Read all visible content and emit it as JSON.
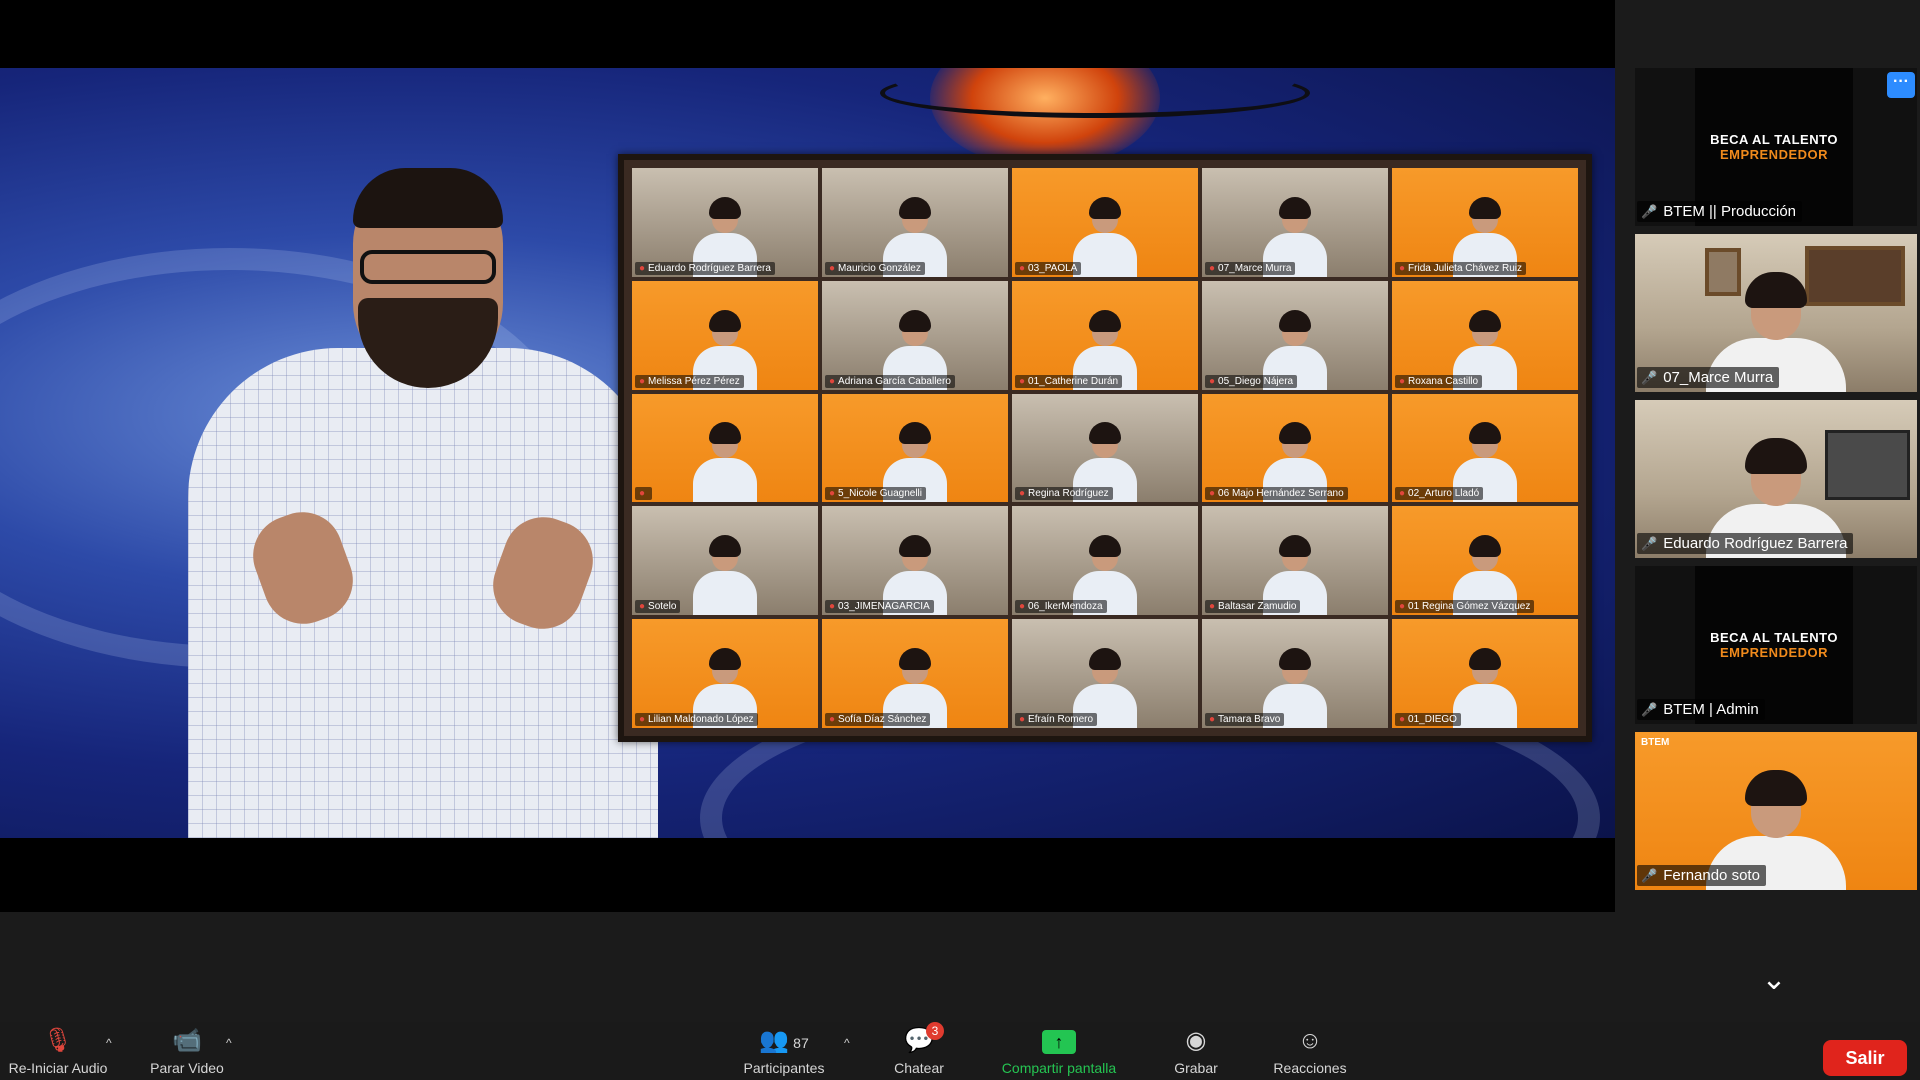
{
  "gallery": {
    "tiles": [
      {
        "name": "Eduardo Rodríguez Barrera",
        "bg": "room"
      },
      {
        "name": "Mauricio González",
        "bg": "room"
      },
      {
        "name": "03_PAOLA",
        "bg": "orange"
      },
      {
        "name": "07_Marce Murra",
        "bg": "room"
      },
      {
        "name": "Frida Julieta Chávez Ruiz",
        "bg": "orange"
      },
      {
        "name": "Melissa Pérez Pérez",
        "bg": "orange"
      },
      {
        "name": "Adriana García Caballero",
        "bg": "room"
      },
      {
        "name": "01_Catherine Durán",
        "bg": "orange"
      },
      {
        "name": "05_Diego Nájera",
        "bg": "room"
      },
      {
        "name": "Roxana Castillo",
        "bg": "orange"
      },
      {
        "name": "",
        "bg": "orange"
      },
      {
        "name": "5_Nicole Guagnelli",
        "bg": "orange"
      },
      {
        "name": "Regina Rodríguez",
        "bg": "room"
      },
      {
        "name": "06 Majo Hernández Serrano",
        "bg": "orange"
      },
      {
        "name": "02_Arturo Lladó",
        "bg": "orange"
      },
      {
        "name": "Sotelo",
        "bg": "room"
      },
      {
        "name": "03_JIMENAGARCIA",
        "bg": "room"
      },
      {
        "name": "06_IkerMendoza",
        "bg": "room"
      },
      {
        "name": "Baltasar Zamudio",
        "bg": "room"
      },
      {
        "name": "01 Regina Gómez Vázquez",
        "bg": "orange"
      },
      {
        "name": "Lilian Maldonado López",
        "bg": "orange"
      },
      {
        "name": "Sofía Díaz Sánchez",
        "bg": "orange"
      },
      {
        "name": "Efraín Romero",
        "bg": "room"
      },
      {
        "name": "Tamara Bravo",
        "bg": "room"
      },
      {
        "name": "01_DIEGO",
        "bg": "orange"
      }
    ]
  },
  "sidebar": {
    "poster_line1": "BECA AL TALENTO",
    "poster_line2": "EMPRENDEDOR",
    "tile1_name": "BTEM || Producción",
    "tile2_name": "07_Marce Murra",
    "tile3_name": "Eduardo Rodríguez Barrera",
    "tile4_name": "BTEM | Admin",
    "tile5_name": "Fernando soto",
    "tile5_logo": "BTEM",
    "more_icon": "more-dots-icon",
    "chevron": "chevron-down-icon"
  },
  "toolbar": {
    "audio_label": "Re-Iniciar Audio",
    "video_label": "Parar Video",
    "participants_label": "Participantes",
    "participants_count": "87",
    "chat_label": "Chatear",
    "chat_badge": "3",
    "share_label": "Compartir pantalla",
    "record_label": "Grabar",
    "reactions_label": "Reacciones",
    "leave_label": "Salir",
    "share_color": "#23c552",
    "leave_color": "#e0241c"
  },
  "colors": {
    "tile_orange": "#f08a1c",
    "mute_red": "#e0463c",
    "accent_blue": "#2d8cff"
  }
}
